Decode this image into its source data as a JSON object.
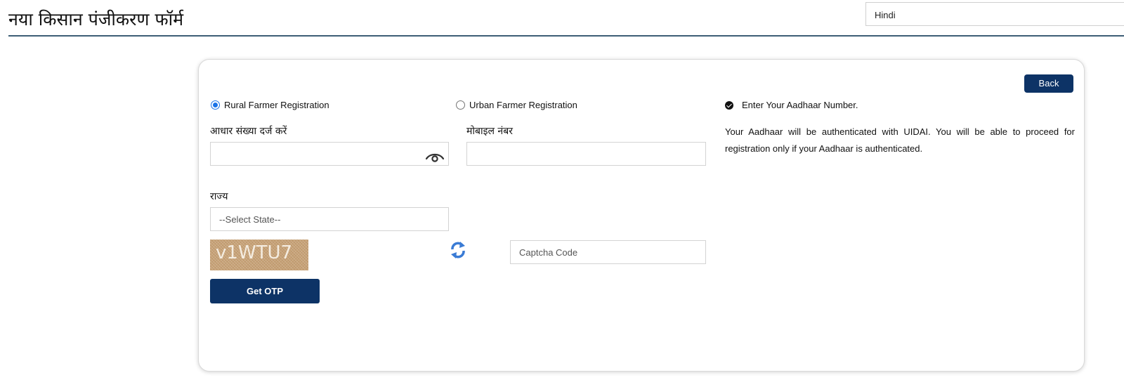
{
  "header": {
    "title": "नया किसान पंजीकरण फॉर्म",
    "language_selected": "Hindi"
  },
  "form": {
    "back_label": "Back",
    "registration_type": {
      "rural_label": "Rural Farmer Registration",
      "urban_label": "Urban Farmer Registration",
      "selected": "rural"
    },
    "aadhaar": {
      "label": "आधार संख्या दर्ज करें",
      "value": ""
    },
    "mobile": {
      "label": "मोबाइल नंबर",
      "value": ""
    },
    "state": {
      "label": "राज्य",
      "selected": "--Select State--"
    },
    "captcha": {
      "image_text": "v1WTU7",
      "input_placeholder": "Captcha Code",
      "refresh_icon": "refresh-icon"
    },
    "get_otp_label": "Get OTP"
  },
  "info": {
    "heading": "Enter Your Aadhaar Number.",
    "body": "Your Aadhaar will be authenticated with UIDAI. You will be able to proceed for registration only if your Aadhaar is authenticated."
  },
  "colors": {
    "primary_button": "#0d3366",
    "header_rule": "#3d5e76",
    "radio_accent": "#1a73e8",
    "refresh_icon": "#3a7bd5",
    "captcha_bg": "#c7a277"
  }
}
